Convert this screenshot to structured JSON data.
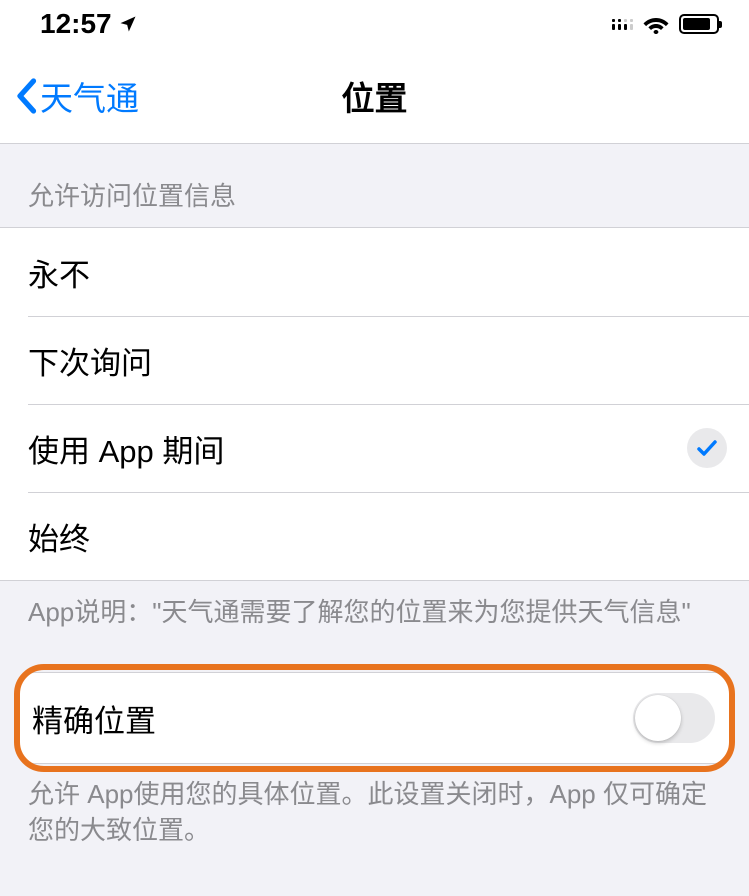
{
  "status": {
    "time": "12:57"
  },
  "nav": {
    "back_label": "天气通",
    "title": "位置"
  },
  "section1": {
    "header": "允许访问位置信息",
    "options": [
      {
        "label": "永不",
        "selected": false
      },
      {
        "label": "下次询问",
        "selected": false
      },
      {
        "label": "使用 App 期间",
        "selected": true
      },
      {
        "label": "始终",
        "selected": false
      }
    ],
    "footer": "App说明：\"天气通需要了解您的位置来为您提供天气信息\""
  },
  "precise": {
    "label": "精确位置",
    "enabled": false,
    "footer": "允许 App使用您的具体位置。此设置关闭时，App 仅可确定您的大致位置。"
  }
}
